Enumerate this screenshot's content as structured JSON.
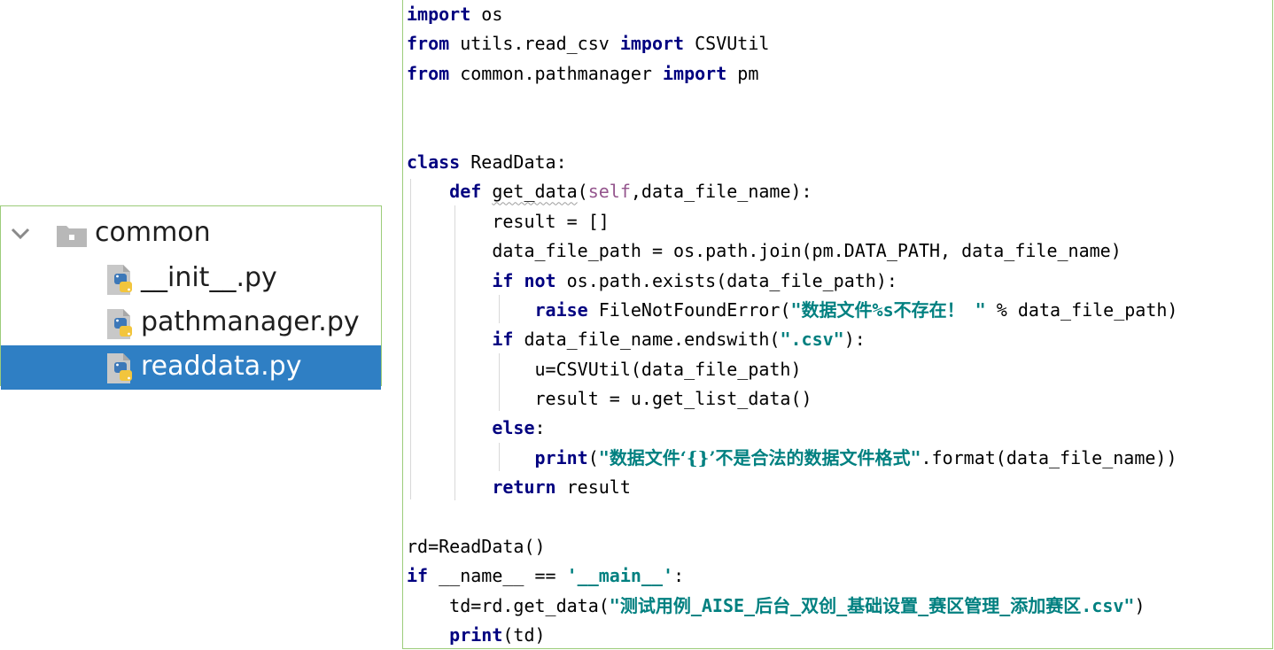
{
  "tree": {
    "folder": {
      "name": "common",
      "expanded": true,
      "icon": "folder-icon"
    },
    "files": [
      {
        "name": "__init__.py",
        "icon": "python-file-icon",
        "selected": false
      },
      {
        "name": "pathmanager.py",
        "icon": "python-file-icon",
        "selected": false
      },
      {
        "name": "readdata.py",
        "icon": "python-file-icon",
        "selected": true
      }
    ],
    "selected_color": "#2f7fc4",
    "border_color": "#9ccc7a"
  },
  "editor": {
    "language": "python",
    "colors": {
      "keyword": "#000080",
      "string": "#008080",
      "self": "#94558d"
    },
    "lines": [
      [
        [
          "import",
          "kw"
        ],
        [
          " os",
          ""
        ]
      ],
      [
        [
          "from",
          "kw"
        ],
        [
          " utils.read_csv ",
          ""
        ],
        [
          "import",
          "kw"
        ],
        [
          " CSVUtil",
          ""
        ]
      ],
      [
        [
          "from",
          "kw"
        ],
        [
          " common.pathmanager ",
          ""
        ],
        [
          "import",
          "kw"
        ],
        [
          " pm",
          ""
        ]
      ],
      [],
      [],
      [
        [
          "class",
          "kw"
        ],
        [
          " ReadData:",
          ""
        ]
      ],
      [
        [
          "    ",
          ""
        ],
        [
          "def",
          "kw"
        ],
        [
          " ",
          ""
        ],
        [
          "get_data",
          "squig"
        ],
        [
          "(",
          ""
        ],
        [
          "self",
          "self"
        ],
        [
          ",data_file_name):",
          ""
        ]
      ],
      [
        [
          "        result = []",
          ""
        ]
      ],
      [
        [
          "        data_file_path = os.path.join(pm.DATA_PATH, data_file_name)",
          ""
        ]
      ],
      [
        [
          "        ",
          ""
        ],
        [
          "if",
          "kw"
        ],
        [
          " ",
          ""
        ],
        [
          "not",
          "kw"
        ],
        [
          " os.path.exists(data_file_path):",
          ""
        ]
      ],
      [
        [
          "            ",
          ""
        ],
        [
          "raise",
          "kw"
        ],
        [
          " FileNotFoundError(",
          ""
        ],
        [
          "\"",
          "str"
        ],
        [
          "数据文件",
          "str cn"
        ],
        [
          "%s",
          "str"
        ],
        [
          "不存在！",
          "str cn"
        ],
        [
          " \"",
          "str"
        ],
        [
          " % data_file_path)",
          ""
        ]
      ],
      [
        [
          "        ",
          ""
        ],
        [
          "if",
          "kw"
        ],
        [
          " data_file_name.endswith(",
          ""
        ],
        [
          "\".csv\"",
          "str"
        ],
        [
          "):",
          ""
        ]
      ],
      [
        [
          "            u=CSVUtil(data_file_path)",
          ""
        ]
      ],
      [
        [
          "            result = u.get_list_data()",
          ""
        ]
      ],
      [
        [
          "        ",
          ""
        ],
        [
          "else",
          "kw"
        ],
        [
          ":",
          ""
        ]
      ],
      [
        [
          "            ",
          ""
        ],
        [
          "print",
          "kw"
        ],
        [
          "(",
          ""
        ],
        [
          "\"",
          "str"
        ],
        [
          "数据文件‘{}’不是合法的数据文件格式",
          "str cn"
        ],
        [
          "\"",
          "str"
        ],
        [
          ".format(data_file_name))",
          ""
        ]
      ],
      [
        [
          "        ",
          ""
        ],
        [
          "return",
          "kw"
        ],
        [
          " result",
          ""
        ]
      ],
      [],
      [
        [
          "rd=ReadData()",
          ""
        ]
      ],
      [
        [
          "if",
          "kw"
        ],
        [
          " __name__ == ",
          ""
        ],
        [
          "'__main__'",
          "str"
        ],
        [
          ":",
          ""
        ]
      ],
      [
        [
          "    td=rd.get_data(",
          ""
        ],
        [
          "\"",
          "str"
        ],
        [
          "测试用例",
          "str cn"
        ],
        [
          "_AISE_",
          "str"
        ],
        [
          "后台",
          "str cn"
        ],
        [
          "_",
          "str"
        ],
        [
          "双创",
          "str cn"
        ],
        [
          "_",
          "str"
        ],
        [
          "基础设置",
          "str cn"
        ],
        [
          "_",
          "str"
        ],
        [
          "赛区管理",
          "str cn"
        ],
        [
          "_",
          "str"
        ],
        [
          "添加赛区",
          "str cn"
        ],
        [
          ".csv\"",
          "str"
        ],
        [
          ")",
          ""
        ]
      ],
      [
        [
          "    ",
          ""
        ],
        [
          "print",
          "kw"
        ],
        [
          "(td)",
          ""
        ]
      ]
    ]
  }
}
